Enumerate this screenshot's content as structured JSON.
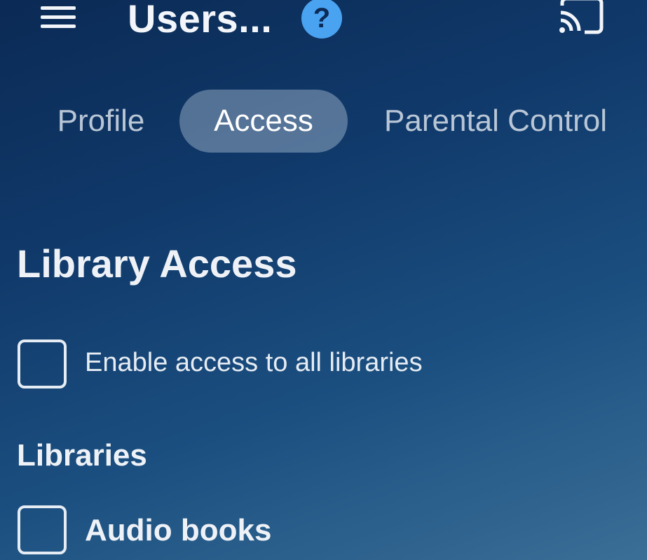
{
  "header": {
    "title": "Users...",
    "menu_icon": "hamburger-menu-icon",
    "help_icon": "help-circle-icon",
    "help_glyph": "?",
    "cast_icon": "cast-icon"
  },
  "tabs": [
    {
      "label": "Profile",
      "active": false
    },
    {
      "label": "Access",
      "active": true
    },
    {
      "label": "Parental Control",
      "active": false
    }
  ],
  "library_access": {
    "title": "Library Access",
    "enable_all": {
      "label": "Enable access to all libraries",
      "checked": false
    }
  },
  "libraries": {
    "title": "Libraries",
    "items": [
      {
        "label": "Audio books",
        "checked": false
      }
    ]
  },
  "colors": {
    "accent": "#4aa3f0",
    "text": "#e6ecf3",
    "bg_top": "#0b2a55",
    "bg_bottom": "#3b6f97"
  }
}
